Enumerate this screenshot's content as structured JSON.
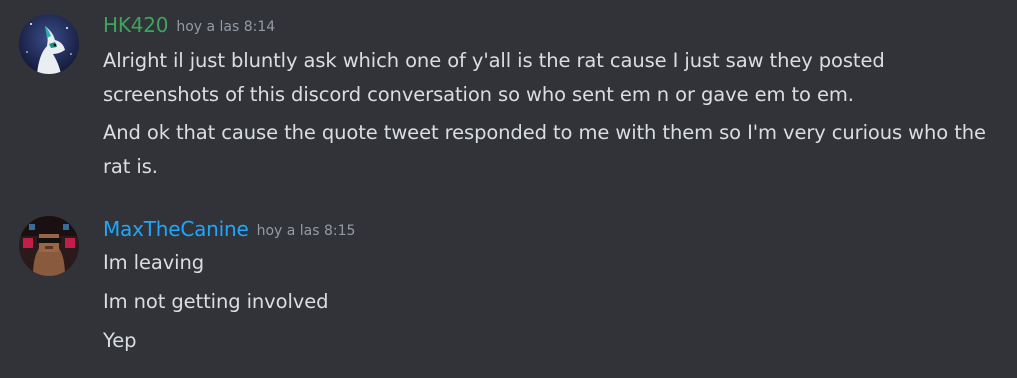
{
  "messages": [
    {
      "author": "HK420",
      "author_color": "#3ba55c",
      "timestamp": "hoy a las 8:14",
      "lines": [
        "Alright il just bluntly ask which one of y'all is the rat cause I just saw they posted screenshots of this discord conversation so who sent em n or gave em to em.",
        "And ok that cause the quote tweet responded to me with them so I'm very curious who the rat is."
      ]
    },
    {
      "author": "MaxTheCanine",
      "author_color": "#1ea7fd",
      "timestamp": "hoy a las 8:15",
      "lines": [
        "Im leaving",
        "Im not getting involved",
        "Yep"
      ]
    }
  ]
}
